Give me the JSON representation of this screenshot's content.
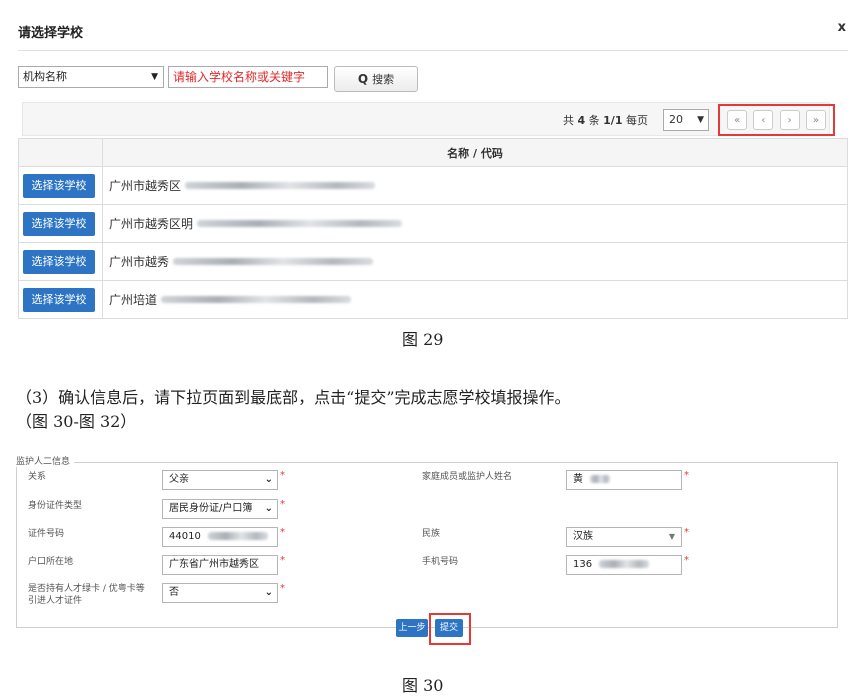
{
  "modal": {
    "title": "请选择学校",
    "close_label": "x",
    "filter_select_value": "机构名称",
    "search_placeholder": "请输入学校名称或关键字",
    "search_button_label": "搜索",
    "pager": {
      "total_prefix": "共",
      "total_count": "4",
      "total_suffix": "条",
      "page_indicator": "1/1",
      "per_page_label": "每页",
      "page_size": "20",
      "first_icon": "«",
      "prev_icon": "‹",
      "next_icon": "›",
      "last_icon": "»"
    },
    "table": {
      "header": "名称 / 代码",
      "select_label": "选择该学校",
      "rows": [
        {
          "name": "广州市越秀区"
        },
        {
          "name": "广州市越秀区明"
        },
        {
          "name": "广州市越秀"
        },
        {
          "name": "广州培道"
        }
      ]
    }
  },
  "caption_29": "图 29",
  "instruction_line1": "（3）确认信息后，请下拉页面到最底部，点击“提交”完成志愿学校填报操作。",
  "instruction_line2": "（图 30-图 32）",
  "guardian_form": {
    "legend": "监护人二信息",
    "relation_label": "关系",
    "relation_value": "父亲",
    "id_type_label": "身份证件类型",
    "id_type_value": "居民身份证/户口簿",
    "id_number_label": "证件号码",
    "id_number_value": "44010",
    "hukou_label": "户口所在地",
    "hukou_value": "广东省广州市越秀区",
    "talent_label_line1": "是否持有人才绿卡 / 优粤卡等",
    "talent_label_line2": "引进人才证件",
    "talent_value": "否",
    "guardian_name_label": "家庭成员或监护人姓名",
    "guardian_name_value": "黄",
    "ethnicity_label": "民族",
    "ethnicity_value": "汉族",
    "phone_label": "手机号码",
    "phone_value": "136",
    "required_mark": "*",
    "prev_button_label": "上一步",
    "submit_button_label": "提交"
  },
  "caption_30": "图 30",
  "colors": {
    "primary_button": "#2d74c4",
    "highlight_border": "#e53935",
    "placeholder_red": "#e0292b"
  }
}
